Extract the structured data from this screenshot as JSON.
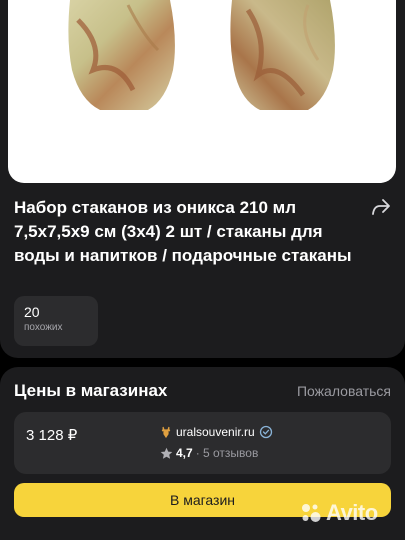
{
  "product": {
    "title": "Набор стаканов из оникса 210 мл 7,5х7,5х9 см (3х4) 2 шт / стаканы для воды и напитков / подарочные стаканы",
    "similar_count": "20",
    "similar_label": "похожих",
    "image_icon": "onyx-glasses-image",
    "share_icon": "share-icon"
  },
  "prices": {
    "title": "Цены в магазинах",
    "login_link": "Пожаловаться",
    "offers": [
      {
        "price": "3 128 ₽",
        "store": "uralsouvenir.ru",
        "rating": "4,7",
        "reviews": "· 5 отзывов"
      }
    ],
    "button_label": "В магазин"
  },
  "watermark": "Avito",
  "colors": {
    "background": "#000000",
    "card": "#1c1c1e",
    "chip": "#2c2c2e",
    "accent_button": "#f7d43b",
    "muted_text": "#9a9aa0"
  }
}
